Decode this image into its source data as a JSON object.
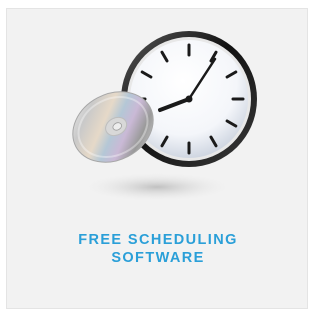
{
  "card": {
    "title_line1": "FREE SCHEDULING",
    "title_line2": "SOFTWARE",
    "illustration": {
      "clock_icon": "wall-clock-icon",
      "disc_icon": "compact-disc-icon"
    },
    "accent_color": "#2a9fd8",
    "background_color": "#f2f2f2"
  }
}
